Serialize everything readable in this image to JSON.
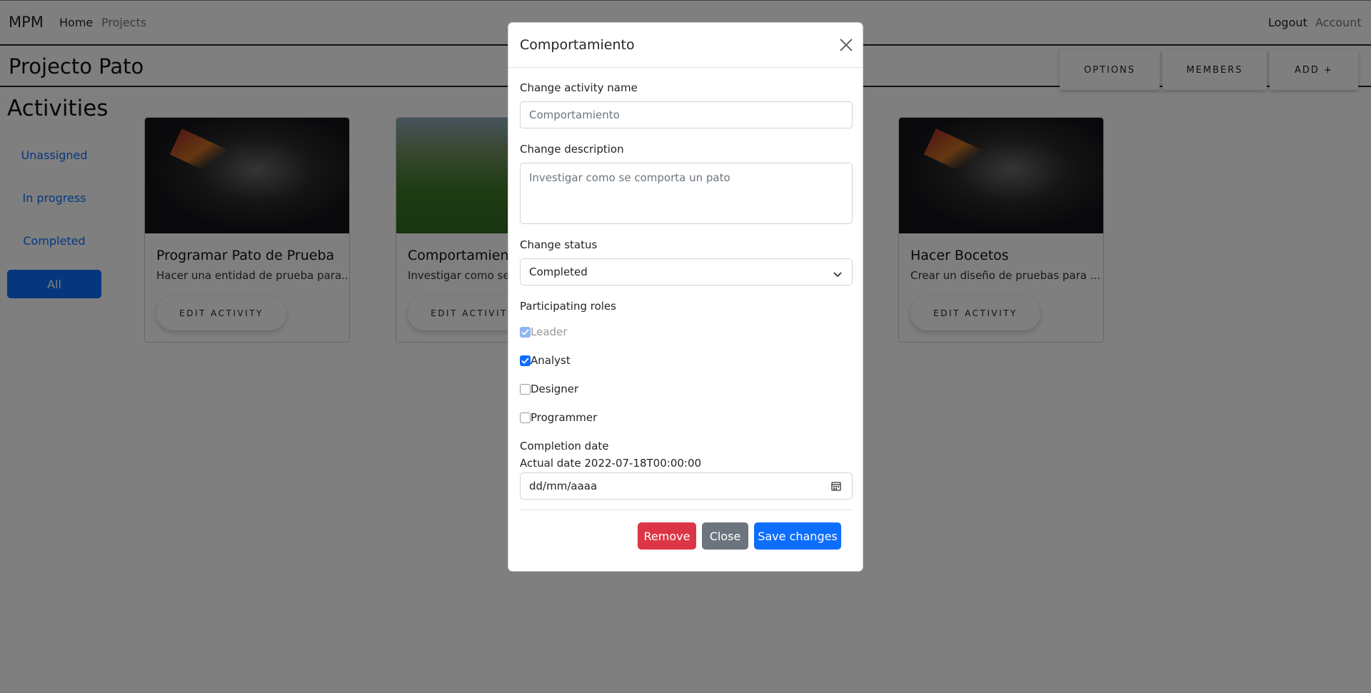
{
  "navbar": {
    "brand": "MPM",
    "home": "Home",
    "projects": "Projects",
    "logout": "Logout",
    "account": "Account"
  },
  "project": {
    "title": "Projecto Pato",
    "buttons": {
      "options": "OPTIONS",
      "members": "MEMBERS",
      "add": "ADD +"
    }
  },
  "sidebar": {
    "title": "Activities",
    "items": [
      {
        "label": "Unassigned"
      },
      {
        "label": "In progress"
      },
      {
        "label": "Completed"
      },
      {
        "label": "All"
      }
    ]
  },
  "cards": [
    {
      "title": "Programar Pato de Prueba",
      "description": "Hacer una entidad de prueba para...",
      "button": "EDIT ACTIVITY"
    },
    {
      "title": "Comportamiento",
      "description": "Investigar como se c",
      "button": "EDIT ACTIVITY"
    },
    {
      "title": "Hacer Bocetos",
      "description": "Crear un diseño de pruebas para ...",
      "button": "EDIT ACTIVITY"
    }
  ],
  "modal": {
    "title": "Comportamiento",
    "name_label": "Change activity name",
    "name_placeholder": "Comportamiento",
    "description_label": "Change description",
    "description_placeholder": "Investigar como se comporta un pato",
    "status_label": "Change status",
    "status_value": "Completed",
    "roles_label": "Participating roles",
    "roles": [
      {
        "label": "Leader",
        "checked": true,
        "disabled": true
      },
      {
        "label": "Analyst",
        "checked": true,
        "disabled": false
      },
      {
        "label": "Designer",
        "checked": false,
        "disabled": false
      },
      {
        "label": "Programmer",
        "checked": false,
        "disabled": false
      }
    ],
    "completion_label": "Completion date",
    "actual_date": "Actual date 2022-07-18T00:00:00",
    "date_placeholder": "dd/mm/aaaa",
    "buttons": {
      "remove": "Remove",
      "close": "Close",
      "save": "Save changes"
    }
  },
  "colors": {
    "primary": "#0d6efd",
    "danger": "#dc3545",
    "secondary": "#6c757d"
  },
  "icons": {
    "close": "close-icon",
    "chevron": "chevron-down-icon",
    "calendar": "calendar-icon",
    "check": "check-icon"
  }
}
